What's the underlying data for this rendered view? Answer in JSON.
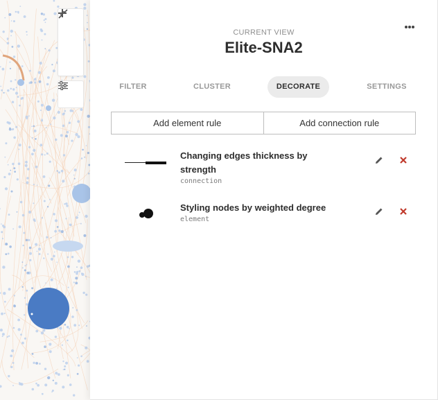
{
  "graph": {
    "zoom_in_icon": "plus-icon",
    "zoom_out_icon": "minus-icon",
    "fit_icon": "compress-arrows-icon",
    "options_icon": "sliders-icon",
    "node_color": "#4a7bc4",
    "light_node_color": "#a9c4e8",
    "edge_color": "#f7d8c0"
  },
  "panel": {
    "more_icon": "ellipsis-icon",
    "caption": "CURRENT VIEW",
    "title": "Elite-SNA2",
    "tabs": [
      {
        "label": "FILTER",
        "active": false
      },
      {
        "label": "CLUSTER",
        "active": false
      },
      {
        "label": "DECORATE",
        "active": true
      },
      {
        "label": "SETTINGS",
        "active": false
      }
    ],
    "add_element_rule": "Add element rule",
    "add_connection_rule": "Add connection rule",
    "rules": [
      {
        "title": "Changing edges thickness by strength",
        "type": "connection",
        "preview_icon": "edge-thickness-icon"
      },
      {
        "title": "Styling nodes by weighted degree",
        "type": "element",
        "preview_icon": "node-size-icon"
      }
    ],
    "edit_icon": "pencil-icon",
    "delete_icon": "close-icon",
    "delete_color": "#c0392b"
  }
}
